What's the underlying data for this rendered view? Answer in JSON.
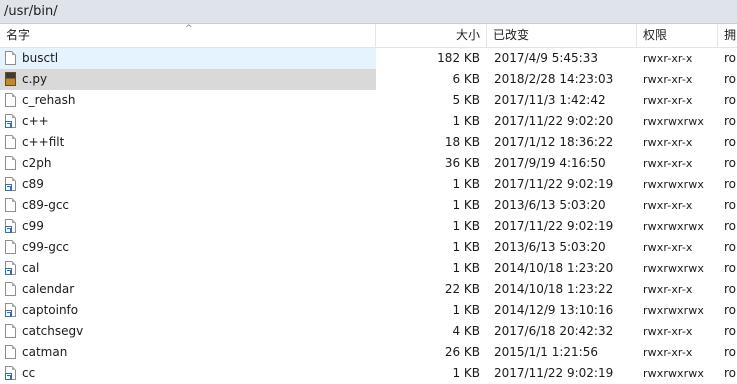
{
  "path": "/usr/bin/",
  "columns": {
    "name": "名字",
    "size": "大小",
    "modified": "已改变",
    "permissions": "权限",
    "owner": "拥"
  },
  "rows": [
    {
      "name": "busctl",
      "size": "182 KB",
      "modified": "2017/4/9 5:45:33",
      "perm": "rwxr-xr-x",
      "owner": "ro",
      "icon": "file-icon",
      "state": "hover"
    },
    {
      "name": "c.py",
      "size": "6 KB",
      "modified": "2018/2/28 14:23:03",
      "perm": "rwxr-xr-x",
      "owner": "ro",
      "icon": "python-file-icon",
      "state": "selected"
    },
    {
      "name": "c_rehash",
      "size": "5 KB",
      "modified": "2017/11/3 1:42:42",
      "perm": "rwxr-xr-x",
      "owner": "ro",
      "icon": "file-icon",
      "state": ""
    },
    {
      "name": "c++",
      "size": "1 KB",
      "modified": "2017/11/22 9:02:20",
      "perm": "rwxrwxrwx",
      "owner": "ro",
      "icon": "symlink-icon",
      "state": ""
    },
    {
      "name": "c++filt",
      "size": "18 KB",
      "modified": "2017/1/12 18:36:22",
      "perm": "rwxr-xr-x",
      "owner": "ro",
      "icon": "file-icon",
      "state": ""
    },
    {
      "name": "c2ph",
      "size": "36 KB",
      "modified": "2017/9/19 4:16:50",
      "perm": "rwxr-xr-x",
      "owner": "ro",
      "icon": "file-icon",
      "state": ""
    },
    {
      "name": "c89",
      "size": "1 KB",
      "modified": "2017/11/22 9:02:19",
      "perm": "rwxrwxrwx",
      "owner": "ro",
      "icon": "symlink-icon",
      "state": ""
    },
    {
      "name": "c89-gcc",
      "size": "1 KB",
      "modified": "2013/6/13 5:03:20",
      "perm": "rwxr-xr-x",
      "owner": "ro",
      "icon": "file-icon",
      "state": ""
    },
    {
      "name": "c99",
      "size": "1 KB",
      "modified": "2017/11/22 9:02:19",
      "perm": "rwxrwxrwx",
      "owner": "ro",
      "icon": "symlink-icon",
      "state": ""
    },
    {
      "name": "c99-gcc",
      "size": "1 KB",
      "modified": "2013/6/13 5:03:20",
      "perm": "rwxr-xr-x",
      "owner": "ro",
      "icon": "file-icon",
      "state": ""
    },
    {
      "name": "cal",
      "size": "1 KB",
      "modified": "2014/10/18 1:23:20",
      "perm": "rwxrwxrwx",
      "owner": "ro",
      "icon": "symlink-icon",
      "state": ""
    },
    {
      "name": "calendar",
      "size": "22 KB",
      "modified": "2014/10/18 1:23:22",
      "perm": "rwxr-xr-x",
      "owner": "ro",
      "icon": "file-icon",
      "state": ""
    },
    {
      "name": "captoinfo",
      "size": "1 KB",
      "modified": "2014/12/9 13:10:16",
      "perm": "rwxrwxrwx",
      "owner": "ro",
      "icon": "symlink-icon",
      "state": ""
    },
    {
      "name": "catchsegv",
      "size": "4 KB",
      "modified": "2017/6/18 20:42:32",
      "perm": "rwxr-xr-x",
      "owner": "ro",
      "icon": "file-icon",
      "state": ""
    },
    {
      "name": "catman",
      "size": "26 KB",
      "modified": "2015/1/1 1:21:56",
      "perm": "rwxr-xr-x",
      "owner": "ro",
      "icon": "file-icon",
      "state": ""
    },
    {
      "name": "cc",
      "size": "1 KB",
      "modified": "2017/11/22 9:02:19",
      "perm": "rwxrwxrwx",
      "owner": "ro",
      "icon": "symlink-icon",
      "state": ""
    }
  ]
}
